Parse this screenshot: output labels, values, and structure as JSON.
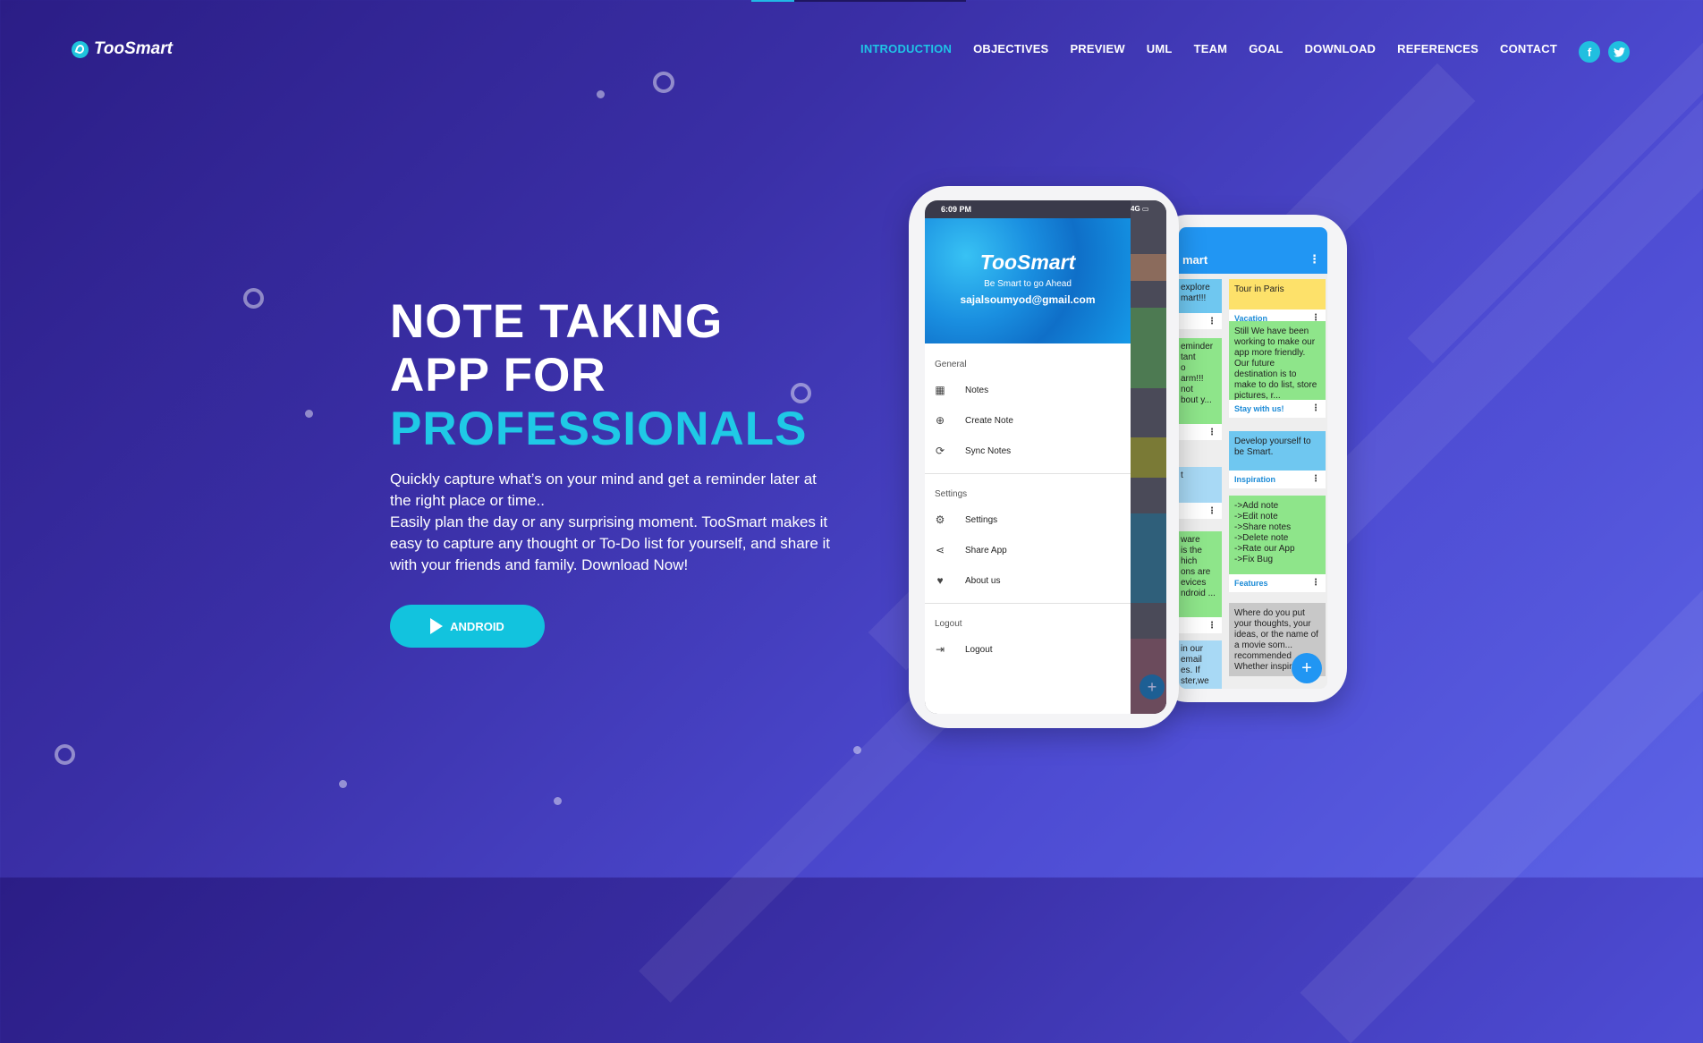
{
  "brand": {
    "name": "TooSmart"
  },
  "nav": {
    "items": [
      "INTRODUCTION",
      "OBJECTIVES",
      "PREVIEW",
      "UML",
      "TEAM",
      "GOAL",
      "DOWNLOAD",
      "REFERENCES",
      "CONTACT"
    ],
    "active": "INTRODUCTION",
    "social": [
      {
        "name": "facebook-icon",
        "glyph": "f"
      },
      {
        "name": "twitter-icon",
        "glyph": "t"
      }
    ]
  },
  "hero": {
    "line1": "NOTE TAKING",
    "line2": "APP FOR",
    "line3": "PROFESSIONALS",
    "desc1": "Quickly capture what’s on your mind and get a reminder later at the right place or time..",
    "desc2": "Easily plan the day or any surprising moment. TooSmart makes it easy to capture any thought or To-Do list for yourself, and share it with your friends and family. Download Now!",
    "button": "ANDROID"
  },
  "phone_front": {
    "status_time": "6:09 PM",
    "status_right": "4G",
    "brand": "TooSmart",
    "tagline": "Be Smart to go Ahead",
    "email": "sajalsoumyod@gmail.com",
    "sections": [
      {
        "title": "General",
        "items": [
          "Notes",
          "Create Note",
          "Sync Notes"
        ]
      },
      {
        "title": "Settings",
        "items": [
          "Settings",
          "Share App",
          "About us"
        ]
      },
      {
        "title": "Logout",
        "items": [
          "Logout"
        ]
      }
    ]
  },
  "phone_back": {
    "appbar_title": "mart",
    "notes_right": [
      {
        "text": "Tour in Paris",
        "tag": "Vacation",
        "color": "#fde16a"
      },
      {
        "text": "Still We have been working to make our app more friendly. Our future destination is to make to do list, store pictures, r...",
        "tag": "Stay with us!",
        "color": "#8ee58a"
      },
      {
        "text": "Develop yourself to be Smart.",
        "tag": "Inspiration",
        "color": "#6fc7f0"
      },
      {
        "text": "->Add note\n->Edit note\n->Share notes\n->Delete note\n->Rate our App\n->Fix Bug",
        "tag": "Features",
        "color": "#8ee58a"
      },
      {
        "text": "Where do you put your thoughts, your ideas, or the name of a movie som... recommended Whether inspiration ...",
        "tag": "",
        "color": "#c8c8c8"
      }
    ],
    "notes_left": [
      {
        "text": "explore\nmart!!!",
        "color": "#6fc7f0"
      },
      {
        "text": "eminder\ntant\no\narm!!!\nnot\nbout y...",
        "color": "#8ee58a"
      },
      {
        "text": "t",
        "color": "#a8d9f5"
      },
      {
        "text": "ware\nis the\nhich\nons are\nevices\nndroid ...",
        "color": "#8ee58a"
      },
      {
        "text": "in our\nemail\nes. If\nster,we\na",
        "color": "#a8d9f5"
      }
    ]
  }
}
